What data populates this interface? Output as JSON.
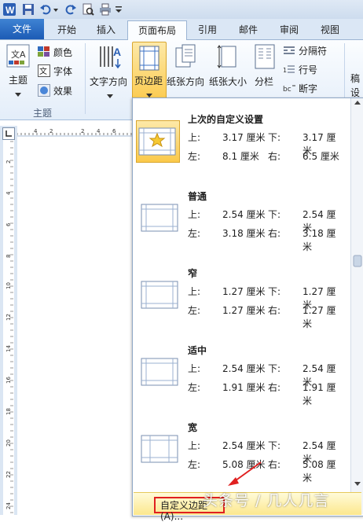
{
  "quick_access": {
    "icons": [
      "word-logo-icon",
      "save-icon",
      "undo-icon",
      "redo-icon",
      "print-preview-icon",
      "print-icon",
      "customize-icon"
    ]
  },
  "tabs": [
    "文件",
    "开始",
    "插入",
    "页面布局",
    "引用",
    "邮件",
    "审阅",
    "视图"
  ],
  "ribbon": {
    "theme": {
      "label": "主题",
      "colors": "颜色",
      "fonts": "字体",
      "effects": "效果",
      "group": "主题"
    },
    "text_direction": "文字方向",
    "margins": "页边距",
    "orientation": "纸张方向",
    "size": "纸张大小",
    "columns": "分栏",
    "breaks": "分隔符",
    "line_numbers": "行号",
    "hyphenation": "断字",
    "watermark_partial": "稿",
    "settings_partial": "设"
  },
  "ruler": {
    "h_ticks": [
      "4",
      "2",
      "",
      "2",
      "4",
      "6"
    ],
    "v_ticks": [
      "2",
      "4",
      "6",
      "8",
      "10",
      "12",
      "14",
      "16",
      "18",
      "20",
      "22",
      "24"
    ]
  },
  "margins_menu": {
    "options": [
      {
        "title": "上次的自定义设置",
        "top_label": "上:",
        "top": "3.17 厘米",
        "bottom_label": "下:",
        "bottom": "3.17 厘米",
        "left_label": "左:",
        "left": "8.1 厘米",
        "right_label": "右:",
        "right": "6.5 厘米",
        "selected": true
      },
      {
        "title": "普通",
        "top_label": "上:",
        "top": "2.54 厘米",
        "bottom_label": "下:",
        "bottom": "2.54 厘米",
        "left_label": "左:",
        "left": "3.18 厘米",
        "right_label": "右:",
        "right": "3.18 厘米",
        "selected": false
      },
      {
        "title": "窄",
        "top_label": "上:",
        "top": "1.27 厘米",
        "bottom_label": "下:",
        "bottom": "1.27 厘米",
        "left_label": "左:",
        "left": "1.27 厘米",
        "right_label": "右:",
        "right": "1.27 厘米",
        "selected": false
      },
      {
        "title": "适中",
        "top_label": "上:",
        "top": "2.54 厘米",
        "bottom_label": "下:",
        "bottom": "2.54 厘米",
        "left_label": "左:",
        "left": "1.91 厘米",
        "right_label": "右:",
        "right": "1.91 厘米",
        "selected": false
      },
      {
        "title": "宽",
        "top_label": "上:",
        "top": "2.54 厘米",
        "bottom_label": "下:",
        "bottom": "2.54 厘米",
        "left_label": "左:",
        "left": "5.08 厘米",
        "right_label": "右:",
        "right": "5.08 厘米",
        "selected": false
      }
    ],
    "custom_button": "自定义边距(A)..."
  },
  "watermark_text": "头条号 / 几人几言",
  "colors": {
    "accent": "#2b6cc4",
    "highlight": "#fce78d",
    "annotation": "#e02020"
  }
}
